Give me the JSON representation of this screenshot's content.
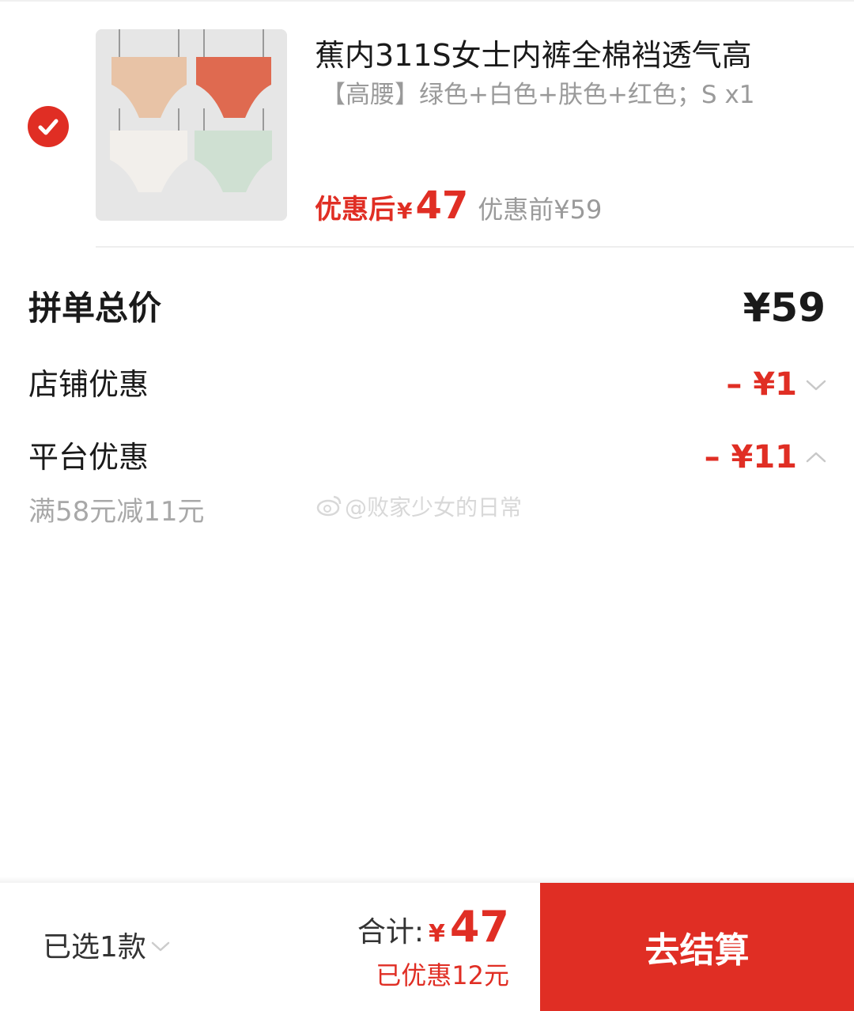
{
  "product": {
    "selected": true,
    "title": "蕉内311S女士内裤全棉裆透气高",
    "spec": "【高腰】绿色+白色+肤色+红色；S x1",
    "price_after_label": "优惠后",
    "currency_symbol": "¥",
    "price_after_value": "47",
    "price_before": "优惠前¥59",
    "image_colors": [
      "#e8c3a6",
      "#df6a50",
      "#efece8",
      "#cfe0d2"
    ]
  },
  "summary": {
    "total_label": "拼单总价",
    "total_value": "¥59",
    "shop_discount_label": "店铺优惠",
    "shop_discount_value": "– ¥1",
    "shop_discount_icon": "chevron-down-icon",
    "platform_discount_label": "平台优惠",
    "platform_discount_value": "– ¥11",
    "platform_discount_icon": "chevron-up-icon",
    "platform_rule": "满58元减11元"
  },
  "watermark": "@败家少女的日常",
  "bottom_bar": {
    "selected_count": "已选1款",
    "total_label": "合计:",
    "total_currency": "¥",
    "total_value": "47",
    "saved_text": "已优惠12元",
    "checkout_label": "去结算"
  },
  "colors": {
    "accent": "#e02e24",
    "muted_text": "#9a9a9a",
    "divider": "#eeeeee"
  }
}
